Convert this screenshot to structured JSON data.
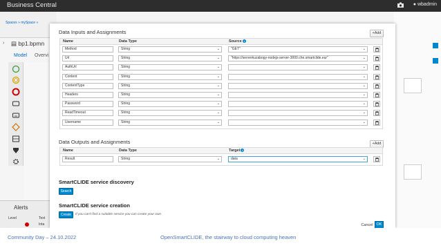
{
  "background": {
    "app_title": "Business Central",
    "user": "wbadmin",
    "breadcrumb": "Spaces  »  mySpace  »",
    "file_name": "bp1.bpmn",
    "tab_model": "Model",
    "tab_overview": "Overvi",
    "alerts_title": "Alerts",
    "alerts_col_level": "Level",
    "alerts_col_text": "Text",
    "alerts_cell_fragment": "Inta"
  },
  "inputs": {
    "title": "Data Inputs and Assignments",
    "add_label": "Add",
    "col_name": "Name",
    "col_type": "Data Type",
    "col_source": "Source",
    "rows": [
      {
        "name": "Method",
        "type": "String",
        "source": "\"GET\""
      },
      {
        "name": "Url",
        "type": "String",
        "source": "\"https://serverkuzabogy-nodejs-server-3000.che.smartclide.eur\""
      },
      {
        "name": "AuthUrl",
        "type": "String",
        "source": ""
      },
      {
        "name": "Content",
        "type": "String",
        "source": ""
      },
      {
        "name": "ContentType",
        "type": "String",
        "source": ""
      },
      {
        "name": "Headers",
        "type": "String",
        "source": ""
      },
      {
        "name": "Password",
        "type": "String",
        "source": ""
      },
      {
        "name": "ReadTimeout",
        "type": "String",
        "source": ""
      },
      {
        "name": "Username",
        "type": "String",
        "source": ""
      }
    ]
  },
  "outputs": {
    "title": "Data Outputs and Assignments",
    "add_label": "Add",
    "col_name": "Name",
    "col_type": "Data Type",
    "col_target": "Target",
    "rows": [
      {
        "name": "Result",
        "type": "String",
        "target": "data"
      }
    ]
  },
  "discovery": {
    "title": "SmartCLIDE service discovery",
    "button": "Search"
  },
  "creation": {
    "title": "SmartCLIDE service creation",
    "button": "Create",
    "hint": "If you can't find a suitable service you can create your own"
  },
  "dialog": {
    "cancel": "Cancel",
    "ok": "OK"
  },
  "footer": {
    "left": "Community Day – 24.10.2022",
    "center": "OpenSmartCLIDE, the stairway to cloud computing heaven"
  },
  "colors": {
    "accent": "#0088ce",
    "footer_text": "#4a73b5",
    "topbar": "#2d2d2d"
  }
}
